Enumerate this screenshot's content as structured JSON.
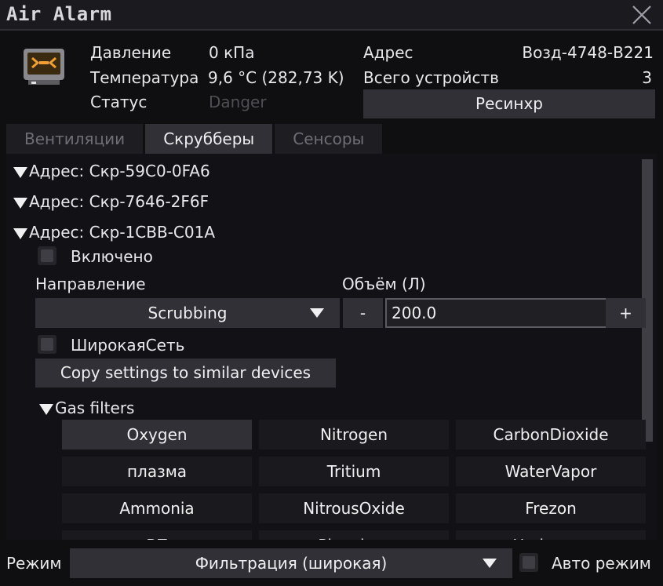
{
  "window": {
    "title": "Air Alarm"
  },
  "info": {
    "pressure_label": "Давление",
    "pressure_value": "0 кПа",
    "temperature_label": "Температура",
    "temperature_value": "9,6 °C (282,73 K)",
    "status_label": "Статус",
    "status_value": "Danger",
    "address_label": "Адрес",
    "address_value": "Возд-4748-B221",
    "devices_label": "Всего устройств",
    "devices_value": "3",
    "resync_label": "Ресинхр"
  },
  "tabs": [
    {
      "label": "Вентиляции"
    },
    {
      "label": "Скрубберы"
    },
    {
      "label": "Сенсоры"
    }
  ],
  "devices": [
    {
      "label": "Адрес: Скр-59C0-0FA6"
    },
    {
      "label": "Адрес: Скр-7646-2F6F"
    },
    {
      "label": "Адрес: Скр-1CBB-C01A"
    }
  ],
  "scrubber": {
    "enabled_label": "Включено",
    "direction_label": "Направление",
    "direction_value": "Scrubbing",
    "volume_label": "Объём (Л)",
    "minus_label": "-",
    "plus_label": "+",
    "volume_value": "200.0",
    "widenet_label": "ШирокаяСеть",
    "copy_label": "Copy settings to similar devices",
    "gas_filters_label": "Gas filters"
  },
  "gases": [
    {
      "label": "Oxygen",
      "on": true
    },
    {
      "label": "Nitrogen",
      "on": false
    },
    {
      "label": "CarbonDioxide",
      "on": false
    },
    {
      "label": "плазма",
      "on": false
    },
    {
      "label": "Tritium",
      "on": false
    },
    {
      "label": "WaterVapor",
      "on": false
    },
    {
      "label": "Ammonia",
      "on": false
    },
    {
      "label": "NitrousOxide",
      "on": false
    },
    {
      "label": "Frezon",
      "on": false
    },
    {
      "label": "BZ",
      "on": false
    },
    {
      "label": "Pluoxium",
      "on": false
    },
    {
      "label": "Hydrogen",
      "on": false
    }
  ],
  "footer": {
    "mode_label": "Режим",
    "mode_value": "Фильтрация (широкая)",
    "auto_label": "Авто режим"
  },
  "colors": {
    "panel": "#121216",
    "button": "#303036",
    "text": "#f0f0f2",
    "dim": "#4e4e54",
    "icon_accent": "#e8962a"
  }
}
